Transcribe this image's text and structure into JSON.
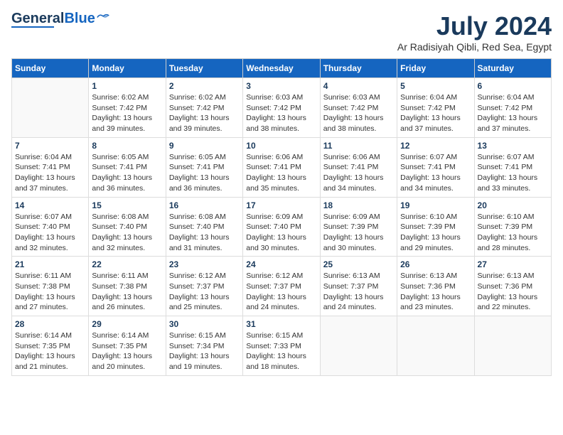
{
  "logo": {
    "line1": "General",
    "line2": "Blue"
  },
  "title": "July 2024",
  "subtitle": "Ar Radisiyah Qibli, Red Sea, Egypt",
  "days_of_week": [
    "Sunday",
    "Monday",
    "Tuesday",
    "Wednesday",
    "Thursday",
    "Friday",
    "Saturday"
  ],
  "weeks": [
    [
      {
        "day": "",
        "info": ""
      },
      {
        "day": "1",
        "info": "Sunrise: 6:02 AM\nSunset: 7:42 PM\nDaylight: 13 hours\nand 39 minutes."
      },
      {
        "day": "2",
        "info": "Sunrise: 6:02 AM\nSunset: 7:42 PM\nDaylight: 13 hours\nand 39 minutes."
      },
      {
        "day": "3",
        "info": "Sunrise: 6:03 AM\nSunset: 7:42 PM\nDaylight: 13 hours\nand 38 minutes."
      },
      {
        "day": "4",
        "info": "Sunrise: 6:03 AM\nSunset: 7:42 PM\nDaylight: 13 hours\nand 38 minutes."
      },
      {
        "day": "5",
        "info": "Sunrise: 6:04 AM\nSunset: 7:42 PM\nDaylight: 13 hours\nand 37 minutes."
      },
      {
        "day": "6",
        "info": "Sunrise: 6:04 AM\nSunset: 7:42 PM\nDaylight: 13 hours\nand 37 minutes."
      }
    ],
    [
      {
        "day": "7",
        "info": "Sunrise: 6:04 AM\nSunset: 7:41 PM\nDaylight: 13 hours\nand 37 minutes."
      },
      {
        "day": "8",
        "info": "Sunrise: 6:05 AM\nSunset: 7:41 PM\nDaylight: 13 hours\nand 36 minutes."
      },
      {
        "day": "9",
        "info": "Sunrise: 6:05 AM\nSunset: 7:41 PM\nDaylight: 13 hours\nand 36 minutes."
      },
      {
        "day": "10",
        "info": "Sunrise: 6:06 AM\nSunset: 7:41 PM\nDaylight: 13 hours\nand 35 minutes."
      },
      {
        "day": "11",
        "info": "Sunrise: 6:06 AM\nSunset: 7:41 PM\nDaylight: 13 hours\nand 34 minutes."
      },
      {
        "day": "12",
        "info": "Sunrise: 6:07 AM\nSunset: 7:41 PM\nDaylight: 13 hours\nand 34 minutes."
      },
      {
        "day": "13",
        "info": "Sunrise: 6:07 AM\nSunset: 7:41 PM\nDaylight: 13 hours\nand 33 minutes."
      }
    ],
    [
      {
        "day": "14",
        "info": "Sunrise: 6:07 AM\nSunset: 7:40 PM\nDaylight: 13 hours\nand 32 minutes."
      },
      {
        "day": "15",
        "info": "Sunrise: 6:08 AM\nSunset: 7:40 PM\nDaylight: 13 hours\nand 32 minutes."
      },
      {
        "day": "16",
        "info": "Sunrise: 6:08 AM\nSunset: 7:40 PM\nDaylight: 13 hours\nand 31 minutes."
      },
      {
        "day": "17",
        "info": "Sunrise: 6:09 AM\nSunset: 7:40 PM\nDaylight: 13 hours\nand 30 minutes."
      },
      {
        "day": "18",
        "info": "Sunrise: 6:09 AM\nSunset: 7:39 PM\nDaylight: 13 hours\nand 30 minutes."
      },
      {
        "day": "19",
        "info": "Sunrise: 6:10 AM\nSunset: 7:39 PM\nDaylight: 13 hours\nand 29 minutes."
      },
      {
        "day": "20",
        "info": "Sunrise: 6:10 AM\nSunset: 7:39 PM\nDaylight: 13 hours\nand 28 minutes."
      }
    ],
    [
      {
        "day": "21",
        "info": "Sunrise: 6:11 AM\nSunset: 7:38 PM\nDaylight: 13 hours\nand 27 minutes."
      },
      {
        "day": "22",
        "info": "Sunrise: 6:11 AM\nSunset: 7:38 PM\nDaylight: 13 hours\nand 26 minutes."
      },
      {
        "day": "23",
        "info": "Sunrise: 6:12 AM\nSunset: 7:37 PM\nDaylight: 13 hours\nand 25 minutes."
      },
      {
        "day": "24",
        "info": "Sunrise: 6:12 AM\nSunset: 7:37 PM\nDaylight: 13 hours\nand 24 minutes."
      },
      {
        "day": "25",
        "info": "Sunrise: 6:13 AM\nSunset: 7:37 PM\nDaylight: 13 hours\nand 24 minutes."
      },
      {
        "day": "26",
        "info": "Sunrise: 6:13 AM\nSunset: 7:36 PM\nDaylight: 13 hours\nand 23 minutes."
      },
      {
        "day": "27",
        "info": "Sunrise: 6:13 AM\nSunset: 7:36 PM\nDaylight: 13 hours\nand 22 minutes."
      }
    ],
    [
      {
        "day": "28",
        "info": "Sunrise: 6:14 AM\nSunset: 7:35 PM\nDaylight: 13 hours\nand 21 minutes."
      },
      {
        "day": "29",
        "info": "Sunrise: 6:14 AM\nSunset: 7:35 PM\nDaylight: 13 hours\nand 20 minutes."
      },
      {
        "day": "30",
        "info": "Sunrise: 6:15 AM\nSunset: 7:34 PM\nDaylight: 13 hours\nand 19 minutes."
      },
      {
        "day": "31",
        "info": "Sunrise: 6:15 AM\nSunset: 7:33 PM\nDaylight: 13 hours\nand 18 minutes."
      },
      {
        "day": "",
        "info": ""
      },
      {
        "day": "",
        "info": ""
      },
      {
        "day": "",
        "info": ""
      }
    ]
  ]
}
